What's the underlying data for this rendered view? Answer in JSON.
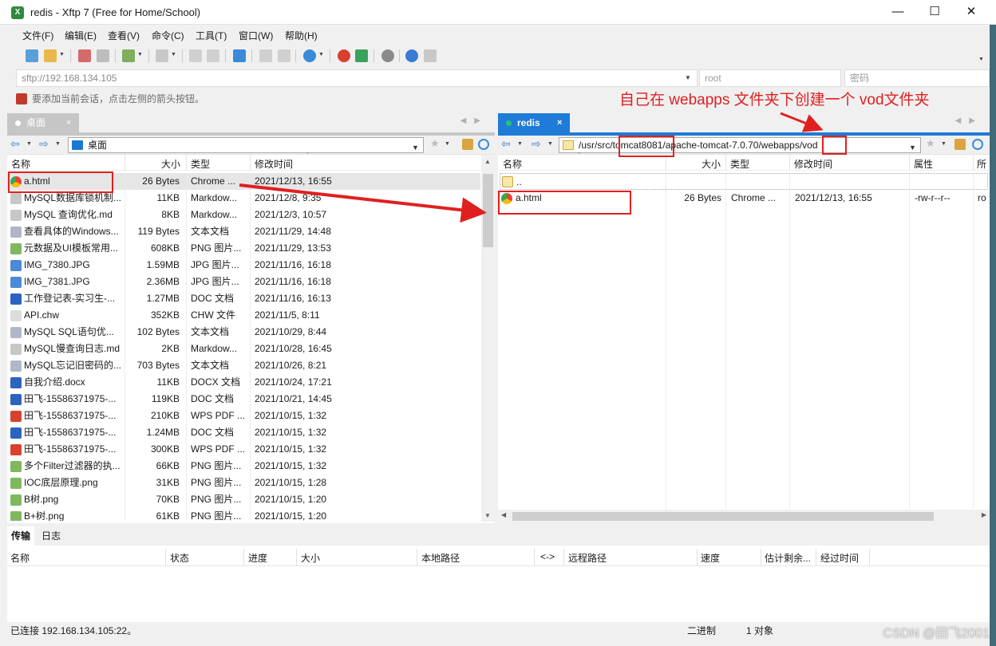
{
  "window": {
    "title": "redis - Xftp 7 (Free for Home/School)",
    "app_icon": "xftp-icon",
    "min": "—",
    "max": "☐",
    "close": "✕"
  },
  "menu": [
    "文件(F)",
    "编辑(E)",
    "查看(V)",
    "命令(C)",
    "工具(T)",
    "窗口(W)",
    "帮助(H)"
  ],
  "address": {
    "host": "sftp://192.168.134.105",
    "user_placeholder": "root",
    "password_placeholder": "密码"
  },
  "hint": "要添加当前会话，点击左侧的箭头按钮。",
  "annotation": "自己在 webapps 文件夹下创建一个 vod文件夹",
  "left_pane": {
    "tab_label": "桌面",
    "tab_close": "×",
    "path": "桌面",
    "columns": [
      "名称",
      "大小",
      "类型",
      "修改时间"
    ],
    "files": [
      {
        "name": "a.html",
        "size": "26 Bytes",
        "type": "Chrome ...",
        "date": "2021/12/13, 16:55",
        "icon": "chrome-icon"
      },
      {
        "name": "MySQL数据库锁机制...",
        "size": "11KB",
        "type": "Markdow...",
        "date": "2021/12/8, 9:35",
        "icon": "markdown-icon"
      },
      {
        "name": "MySQL 查询优化.md",
        "size": "8KB",
        "type": "Markdow...",
        "date": "2021/12/3, 10:57",
        "icon": "markdown-icon"
      },
      {
        "name": "查看具体的Windows...",
        "size": "119 Bytes",
        "type": "文本文档",
        "date": "2021/11/29, 14:48",
        "icon": "text-icon"
      },
      {
        "name": "元数据及UI模板常用...",
        "size": "608KB",
        "type": "PNG 图片...",
        "date": "2021/11/29, 13:53",
        "icon": "png-icon"
      },
      {
        "name": "IMG_7380.JPG",
        "size": "1.59MB",
        "type": "JPG 图片...",
        "date": "2021/11/16, 16:18",
        "icon": "jpg-icon"
      },
      {
        "name": "IMG_7381.JPG",
        "size": "2.36MB",
        "type": "JPG 图片...",
        "date": "2021/11/16, 16:18",
        "icon": "jpg-icon"
      },
      {
        "name": "工作登记表-实习生-...",
        "size": "1.27MB",
        "type": "DOC 文档",
        "date": "2021/11/16, 16:13",
        "icon": "doc-icon"
      },
      {
        "name": "API.chw",
        "size": "352KB",
        "type": "CHW 文件",
        "date": "2021/11/5, 8:11",
        "icon": "file-icon"
      },
      {
        "name": "MySQL SQL语句优...",
        "size": "102 Bytes",
        "type": "文本文档",
        "date": "2021/10/29, 8:44",
        "icon": "text-icon"
      },
      {
        "name": "MySQL慢查询日志.md",
        "size": "2KB",
        "type": "Markdow...",
        "date": "2021/10/28, 16:45",
        "icon": "markdown-icon"
      },
      {
        "name": "MySQL忘记旧密码的...",
        "size": "703 Bytes",
        "type": "文本文档",
        "date": "2021/10/26, 8:21",
        "icon": "text-icon"
      },
      {
        "name": "自我介绍.docx",
        "size": "11KB",
        "type": "DOCX 文档",
        "date": "2021/10/24, 17:21",
        "icon": "docx-icon"
      },
      {
        "name": "田飞-15586371975-...",
        "size": "119KB",
        "type": "DOC 文档",
        "date": "2021/10/21, 14:45",
        "icon": "doc-icon"
      },
      {
        "name": "田飞-15586371975-...",
        "size": "210KB",
        "type": "WPS PDF ...",
        "date": "2021/10/15, 1:32",
        "icon": "pdf-icon"
      },
      {
        "name": "田飞-15586371975-...",
        "size": "1.24MB",
        "type": "DOC 文档",
        "date": "2021/10/15, 1:32",
        "icon": "doc-icon"
      },
      {
        "name": "田飞-15586371975-...",
        "size": "300KB",
        "type": "WPS PDF ...",
        "date": "2021/10/15, 1:32",
        "icon": "pdf-icon"
      },
      {
        "name": "多个Filter过滤器的执...",
        "size": "66KB",
        "type": "PNG 图片...",
        "date": "2021/10/15, 1:32",
        "icon": "png-icon"
      },
      {
        "name": "IOC底层原理.png",
        "size": "31KB",
        "type": "PNG 图片...",
        "date": "2021/10/15, 1:28",
        "icon": "png-icon"
      },
      {
        "name": "B树.png",
        "size": "70KB",
        "type": "PNG 图片...",
        "date": "2021/10/15, 1:20",
        "icon": "png-icon"
      },
      {
        "name": "B+树.png",
        "size": "61KB",
        "type": "PNG 图片...",
        "date": "2021/10/15, 1:20",
        "icon": "png-icon"
      }
    ]
  },
  "right_pane": {
    "tab_label": "redis",
    "tab_close": "×",
    "path": {
      "part1": "/usr/src/",
      "part2": "tomcat8081",
      "part3": "/apache-tomcat-7.0.70/webapps/",
      "part4": "vod"
    },
    "columns": [
      "名称",
      "大小",
      "类型",
      "修改时间",
      "属性",
      "所"
    ],
    "up_dir": "..",
    "files": [
      {
        "name": "a.html",
        "size": "26 Bytes",
        "type": "Chrome ...",
        "date": "2021/12/13, 16:55",
        "attr": "-rw-r--r--",
        "owner": "ro",
        "icon": "chrome-icon"
      }
    ]
  },
  "transfer": {
    "tabs": [
      "传输",
      "日志"
    ],
    "columns": [
      "名称",
      "状态",
      "进度",
      "大小",
      "本地路径",
      "<->",
      "远程路径",
      "速度",
      "估计剩余...",
      "经过时间"
    ]
  },
  "status": {
    "connection": "已连接 192.168.134.105:22。",
    "mode": "二进制",
    "count": "1 对象"
  },
  "watermark": "CSDN @田飞2001",
  "colors": {
    "accent": "#1f7bd8",
    "annotation": "#e02020",
    "folder": "#f2c94c"
  }
}
